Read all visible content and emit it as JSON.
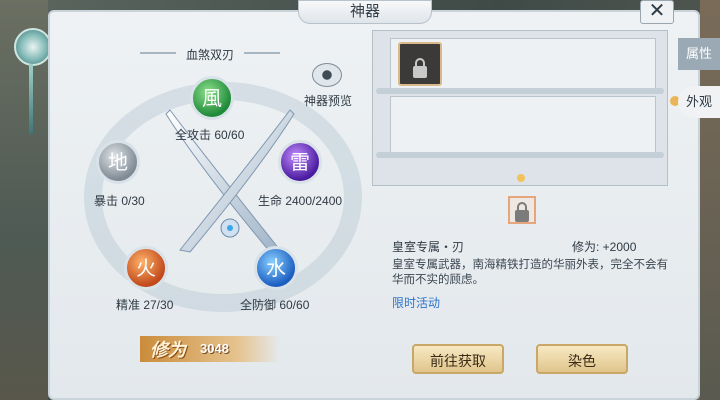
{
  "window": {
    "title": "神器",
    "close_glyph": "✕"
  },
  "weapon": {
    "name": "血煞双刃",
    "preview_label": "神器预览",
    "stats": [
      {
        "glyph": "風",
        "label": "全攻击 60/60",
        "color": "#1f8a3a"
      },
      {
        "glyph": "雷",
        "label": "生命 2400/2400",
        "color": "#4a1b9f"
      },
      {
        "glyph": "地",
        "label": "暴击 0/30",
        "color": "#7f8a94"
      },
      {
        "glyph": "火",
        "label": "精准 27/30",
        "color": "#c1491a"
      },
      {
        "glyph": "水",
        "label": "全防御 60/60",
        "color": "#1b5ec2"
      }
    ],
    "cultivation_label": "修为",
    "cultivation_value": "3048"
  },
  "item": {
    "title": "皇室专属・刃",
    "attribute": "修为:  +2000",
    "description": "皇室专属武器，南海精铁打造的华丽外表，完全不会有华而不实的顾虑。",
    "link": "限时活动"
  },
  "buttons": {
    "get": "前往获取",
    "dye": "染色"
  },
  "tabs": {
    "attributes": "属性",
    "appearance": "外观"
  },
  "colors": {
    "accent_gold": "#e0c58c",
    "link_blue": "#2d74c9"
  }
}
